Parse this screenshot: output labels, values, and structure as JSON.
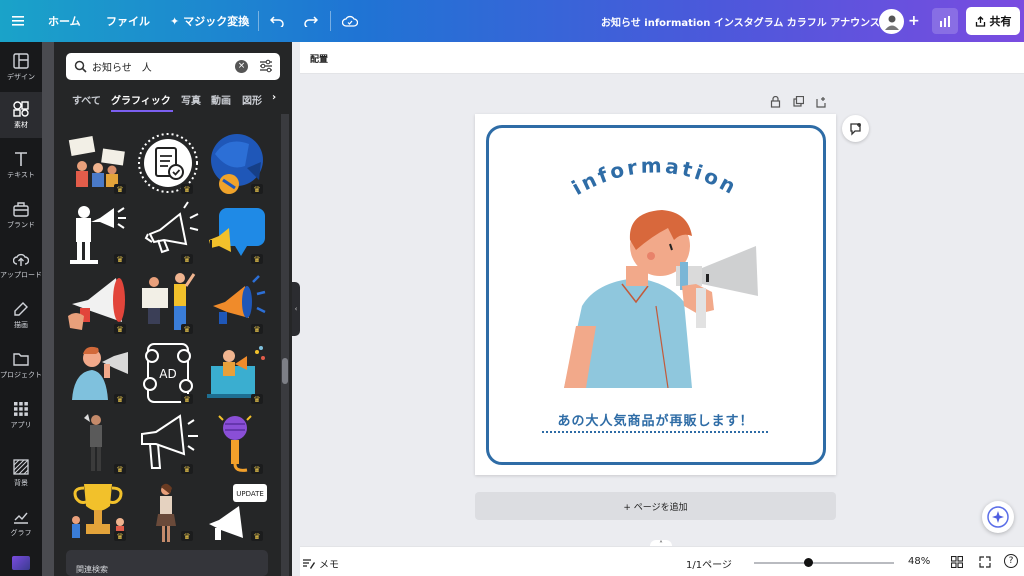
{
  "topbar": {
    "home": "ホーム",
    "file": "ファイル",
    "magic": "マジック変換",
    "title": "お知らせ information インスタグラム カラフル アナウンス",
    "share": "共有"
  },
  "rail": {
    "design": "デザイン",
    "elements": "素材",
    "text": "テキスト",
    "brand": "ブランド",
    "upload": "アップロード",
    "draw": "描画",
    "projects": "プロジェクト",
    "apps": "アプリ",
    "background": "背景",
    "graph": "グラフ"
  },
  "panel": {
    "search_value": "お知らせ　人",
    "tabs": [
      "すべて",
      "グラフィック",
      "写真",
      "動画",
      "図形"
    ],
    "related": "関連検索"
  },
  "grid_items": [
    "protest-people",
    "document-badge",
    "blue-megaphone-head",
    "man-with-megaphone-silhouette",
    "megaphone-outline",
    "speech-bubble-megaphone",
    "red-megaphone",
    "people-with-signs",
    "orange-megaphone",
    "man-megaphone-blue-shirt",
    "ad-phone-icons",
    "woman-laptop-megaphone",
    "man-standing",
    "megaphone-line-art",
    "purple-microphone",
    "trophy-people",
    "woman-standing",
    "update-megaphone"
  ],
  "canvas": {
    "subheader": "配置",
    "design_word": "information",
    "headline": "あの大人気商品が再販します！",
    "add_page": "+ ページを追加"
  },
  "bottombar": {
    "memo": "メモ",
    "pages": "1/1ページ",
    "zoom": "48%"
  },
  "colors": {
    "brand_blue": "#2e6ca6",
    "accent_purple": "#7b5ff0",
    "panel_bg": "#252627"
  }
}
